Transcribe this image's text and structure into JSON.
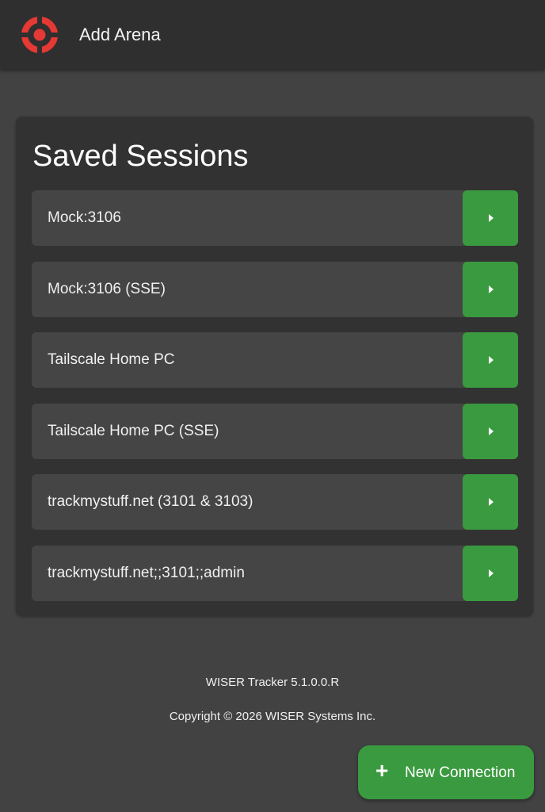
{
  "header": {
    "title": "Add Arena",
    "logo_icon": "target-icon",
    "logo_color": "#e53935"
  },
  "saved_sessions": {
    "title": "Saved Sessions",
    "items": [
      {
        "label": "Mock:3106"
      },
      {
        "label": "Mock:3106 (SSE)"
      },
      {
        "label": "Tailscale Home PC"
      },
      {
        "label": "Tailscale Home PC (SSE)"
      },
      {
        "label": "trackmystuff.net (3101 & 3103)"
      },
      {
        "label": "trackmystuff.net;;3101;;admin"
      }
    ],
    "go_icon": "play-icon"
  },
  "footer": {
    "version": "WISER Tracker 5.1.0.0.R",
    "copyright": "Copyright © 2026 WISER Systems Inc."
  },
  "fab": {
    "label": "New Connection",
    "icon": "plus-icon"
  },
  "colors": {
    "accent_green": "#3a9a3f",
    "header_bg": "#2f2f2f",
    "page_bg": "#424242",
    "card_bg": "#323232",
    "row_bg": "#454545"
  }
}
